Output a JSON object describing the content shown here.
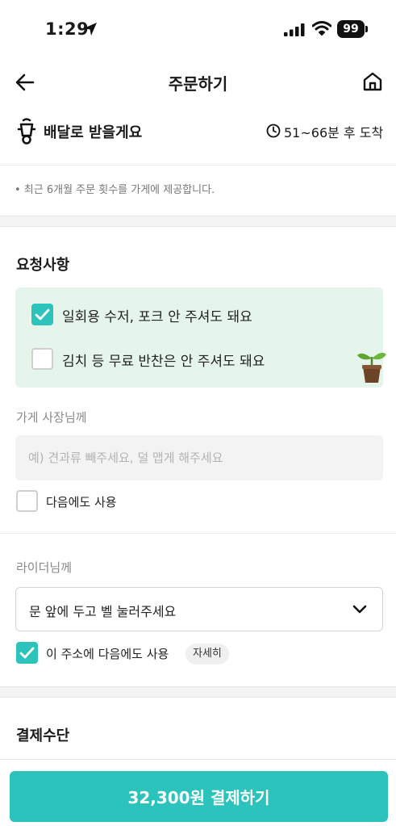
{
  "status_bar": {
    "time": "1:29",
    "battery": "99"
  },
  "nav": {
    "title": "주문하기"
  },
  "delivery": {
    "label": "배달로 받을게요",
    "eta": "51~66분 후 도착"
  },
  "notice": "• 최근 6개월 주문 횟수를 가게에 제공합니다.",
  "requests": {
    "title": "요청사항",
    "options": [
      {
        "label": "일회용 수저, 포크 안 주셔도 돼요",
        "checked": true
      },
      {
        "label": "김치 등 무료 반찬은 안 주셔도 돼요",
        "checked": false
      }
    ]
  },
  "owner": {
    "label": "가게 사장님께",
    "placeholder": "예) 견과류 빼주세요, 덜 맵게 해주세요",
    "value": "",
    "reuse_label": "다음에도 사용",
    "reuse_checked": false
  },
  "rider": {
    "label": "라이더님께",
    "selected": "문 앞에 두고 벨 눌러주세요",
    "reuse_label": "이 주소에 다음에도 사용",
    "reuse_checked": true,
    "detail_label": "자세히"
  },
  "payment": {
    "title": "결제수단"
  },
  "pay_button": {
    "label": "32,300원 결제하기"
  },
  "colors": {
    "accent": "#2cc3bd",
    "request_bg": "#e6f5ec"
  },
  "icons": [
    "location-arrow-icon",
    "signal-icon",
    "wifi-icon",
    "battery-icon",
    "back-arrow-icon",
    "home-icon",
    "scooter-icon",
    "clock-icon",
    "checkmark-icon",
    "sprout-icon",
    "chevron-down-icon"
  ]
}
